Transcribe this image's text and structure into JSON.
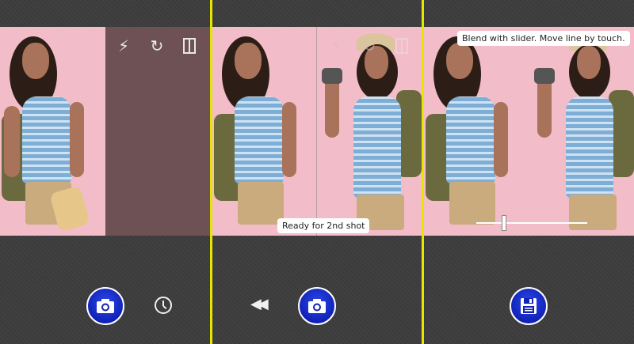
{
  "panels": {
    "second": {
      "toast": "Ready for 2nd shot"
    },
    "third": {
      "toast": "Blend with slider. Move line by touch.",
      "slider_value": 0.25
    }
  },
  "icons": {
    "flash_auto": "flash-auto-icon",
    "switch_camera": "switch-camera-icon",
    "split_mode": "split-mode-icon",
    "camera": "camera-icon",
    "timer": "clock-icon",
    "rewind": "rewind-icon",
    "save": "save-icon"
  },
  "colors": {
    "divider": "#e6e600",
    "button_blue": "#1022b8",
    "photo_bg": "#f3bcc9"
  }
}
